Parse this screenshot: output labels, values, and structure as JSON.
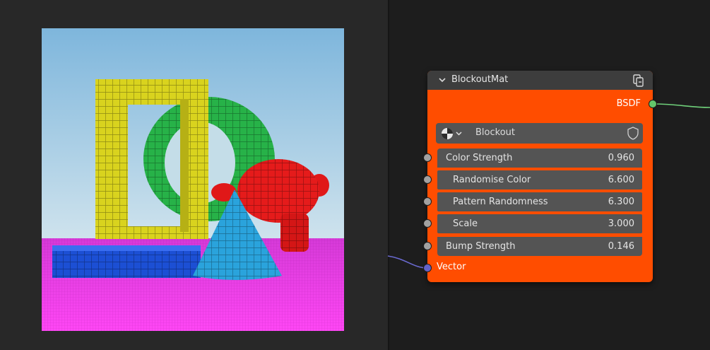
{
  "node": {
    "title": "BlockoutMat",
    "output_label": "BSDF",
    "group_name": "Blockout",
    "fields": [
      {
        "label": "Color Strength",
        "value": "0.960",
        "indent": false
      },
      {
        "label": "Randomise Color",
        "value": "6.600",
        "indent": true
      },
      {
        "label": "Pattern Randomness",
        "value": "6.300",
        "indent": true
      },
      {
        "label": "Scale",
        "value": "3.000",
        "indent": true
      },
      {
        "label": "Bump Strength",
        "value": "0.146",
        "indent": false
      }
    ],
    "vector_label": "Vector"
  },
  "colors": {
    "node_body": "#ff4d00",
    "node_header": "#3d3d3d",
    "shader_socket": "#64c76a",
    "float_socket": "#a1a1a1",
    "vector_socket": "#6363c7"
  },
  "icons": {
    "collapse": "chevron-down-icon",
    "group": "node-group-icon",
    "browse": "material-sphere-icon",
    "fake_user": "shield-icon"
  }
}
